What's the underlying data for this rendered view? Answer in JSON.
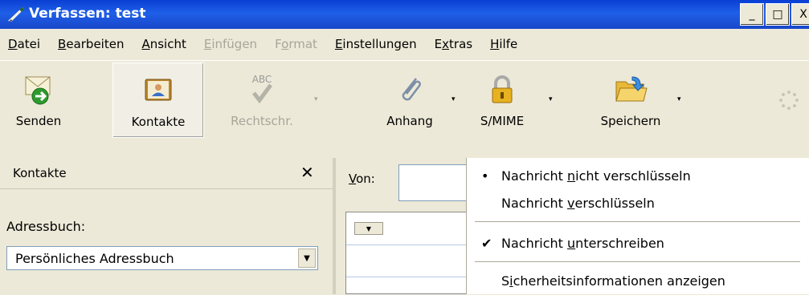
{
  "window": {
    "title": "Verfassen: test",
    "controls": [
      "_",
      "□",
      "X"
    ]
  },
  "menubar": [
    {
      "label": "Datei",
      "disabled": false
    },
    {
      "label": "Bearbeiten",
      "disabled": false
    },
    {
      "label": "Ansicht",
      "disabled": false
    },
    {
      "label": "Einfügen",
      "disabled": true
    },
    {
      "label": "Format",
      "disabled": true
    },
    {
      "label": "Einstellungen",
      "disabled": false
    },
    {
      "label": "Extras",
      "disabled": false
    },
    {
      "label": "Hilfe",
      "disabled": false
    }
  ],
  "toolbar": {
    "send": {
      "label": "Senden",
      "icon": "send-icon"
    },
    "contacts": {
      "label": "Kontakte",
      "icon": "address-book-icon",
      "pressed": true
    },
    "spellcheck": {
      "label": "Rechtschr.",
      "icon": "spellcheck-icon",
      "icon_text": "ABC",
      "disabled": true
    },
    "attach": {
      "label": "Anhang",
      "icon": "paperclip-icon"
    },
    "smime": {
      "label": "S/MIME",
      "icon": "padlock-icon"
    },
    "save": {
      "label": "Speichern",
      "icon": "folder-icon"
    },
    "dropdown_glyph": "▾"
  },
  "sidebar": {
    "title": "Kontakte",
    "close_glyph": "✕",
    "addressbook_label": "Adressbuch:",
    "addressbook_value": "Persönliches Adressbuch"
  },
  "compose": {
    "from_label": "Von:"
  },
  "smime_menu": {
    "items": [
      {
        "label": "Nachricht nicht verschlüsseln",
        "mark": "•"
      },
      {
        "label": "Nachricht verschlüsseln",
        "mark": ""
      },
      {
        "label": "Nachricht unterschreiben",
        "mark": "✔"
      },
      {
        "label": "Sicherheitsinformationen anzeigen",
        "mark": ""
      }
    ]
  }
}
